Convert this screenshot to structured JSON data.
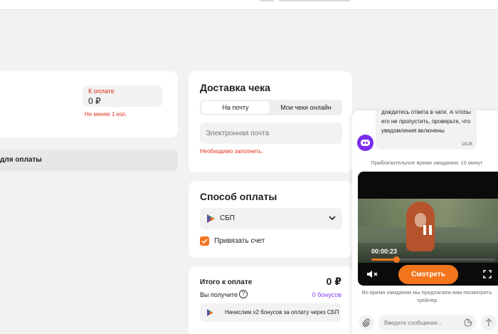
{
  "left_card": {
    "pay_label": "К оплате",
    "pay_value": "0 ₽",
    "min_error": "Не менее 1 коп."
  },
  "method_bar": {
    "label": "для оплаты"
  },
  "delivery": {
    "title": "Доставка чека",
    "tabs": [
      {
        "label": "На почту",
        "active": true
      },
      {
        "label": "Мои чеки онлайн",
        "active": false
      }
    ],
    "email_placeholder": "Электронная почта",
    "error": "Необходимо заполнить."
  },
  "payment_method": {
    "title": "Способ оплаты",
    "selected": "СБП",
    "link_account_label": "Привязать счет",
    "link_account_checked": true
  },
  "total": {
    "title": "Итого к оплате",
    "value": "0 ₽",
    "receive_label": "Вы получите",
    "bonus_value": "0 бонусов",
    "bonus_banner": "Начислим x2 бонусов за оплату через СБП"
  },
  "chat": {
    "message_text": "дождитесь ответа в чате. А чтобы его не пропустить, проверьте, что уведомления включены",
    "message_time": "18:26",
    "wait_text": "Приблизительное время ожидания: 10 минут",
    "video": {
      "time": "00:00:23",
      "progress_fraction": 0.2,
      "watch_button": "Смотреть"
    },
    "trailer_note": "Во время ожидания мы предлагаем вам посмотреть трейлер",
    "input_placeholder": "Введите сообщение..."
  },
  "colors": {
    "accent_orange": "#f5751d",
    "error_red": "#e0301e",
    "bonus_purple": "#8a3ff0",
    "bot_purple": "#7b2cf0"
  }
}
